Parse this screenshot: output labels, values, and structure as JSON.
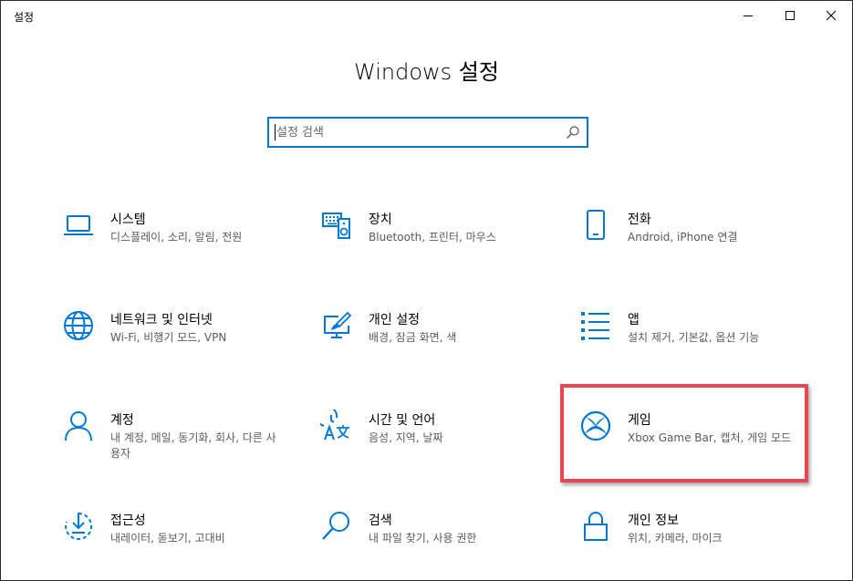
{
  "window": {
    "title": "설정",
    "controls": {
      "minimize": "minimize-icon",
      "maximize": "maximize-icon",
      "close": "close-icon"
    }
  },
  "header": {
    "title": "Windows 설정"
  },
  "search": {
    "placeholder": "설정 검색",
    "value": "",
    "icon": "search-icon"
  },
  "accent_color": "#0078d7",
  "highlight_color": "#e8474f",
  "categories": [
    {
      "name": "시스템",
      "desc": "디스플레이, 소리, 알림, 전원",
      "icon": "laptop-icon"
    },
    {
      "name": "장치",
      "desc": "Bluetooth, 프린터, 마우스",
      "icon": "keyboard-speaker-icon"
    },
    {
      "name": "전화",
      "desc": "Android, iPhone 연결",
      "icon": "phone-icon"
    },
    {
      "name": "네트워크 및 인터넷",
      "desc": "Wi-Fi, 비행기 모드, VPN",
      "icon": "globe-icon"
    },
    {
      "name": "개인 설정",
      "desc": "배경, 잠금 화면, 색",
      "icon": "paint-screen-icon"
    },
    {
      "name": "앱",
      "desc": "설치 제거, 기본값, 옵션 기능",
      "icon": "app-list-icon"
    },
    {
      "name": "계정",
      "desc": "내 계정, 메일, 동기화, 회사, 다른 사용자",
      "icon": "person-icon"
    },
    {
      "name": "시간 및 언어",
      "desc": "음성, 지역, 날짜",
      "icon": "time-language-icon"
    },
    {
      "name": "게임",
      "desc": "Xbox Game Bar, 캡처, 게임 모드",
      "icon": "xbox-icon"
    },
    {
      "name": "접근성",
      "desc": "내레이터, 돋보기, 고대비",
      "icon": "ease-of-access-icon"
    },
    {
      "name": "검색",
      "desc": "내 파일 찾기, 사용 권한",
      "icon": "magnifier-icon"
    },
    {
      "name": "개인 정보",
      "desc": "위치, 카메라, 마이크",
      "icon": "lock-icon"
    }
  ]
}
